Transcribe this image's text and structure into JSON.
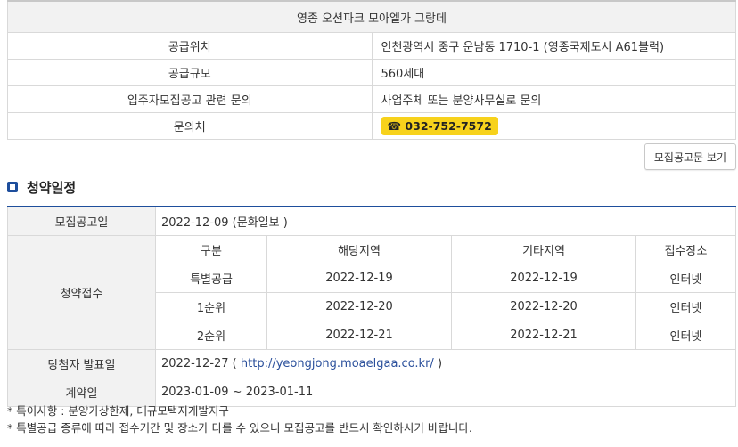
{
  "info": {
    "title": "영종 오션파크 모아엘가 그랑데",
    "rows": [
      {
        "label": "공급위치",
        "value": "인천광역시 중구 운남동 1710-1 (영종국제도시 A61블럭)"
      },
      {
        "label": "공급규모",
        "value": "560세대"
      },
      {
        "label": "입주자모집공고 관련 문의",
        "value": "사업주체 또는 분양사무실로 문의"
      },
      {
        "label": "문의처",
        "value": "☎ 032-752-7572"
      }
    ]
  },
  "notice_button": "모집공고문 보기",
  "section_title": "청약일정",
  "schedule": {
    "announce_label": "모집공고일",
    "announce_value": "2022-12-09 (문화일보 )",
    "receipt_label": "청약접수",
    "headers": [
      "구분",
      "해당지역",
      "기타지역",
      "접수장소"
    ],
    "rows": [
      [
        "특별공급",
        "2022-12-19",
        "2022-12-19",
        "인터넷"
      ],
      [
        "1순위",
        "2022-12-20",
        "2022-12-20",
        "인터넷"
      ],
      [
        "2순위",
        "2022-12-21",
        "2022-12-21",
        "인터넷"
      ]
    ],
    "winner_label": "당첨자 발표일",
    "winner_date": "2022-12-27 ( ",
    "winner_link": "http://yeongjong.moaelgaa.co.kr/",
    "winner_close": " )",
    "contract_label": "계약일",
    "contract_value": "2023-01-09 ~ 2023-01-11"
  },
  "notes": [
    "* 특이사항 : 분양가상한제, 대규모택지개발지구",
    "* 특별공급 종류에 따라 접수기간 및 장소가 다를 수 있으니 모집공고를 반드시 확인하시기 바랍니다."
  ]
}
